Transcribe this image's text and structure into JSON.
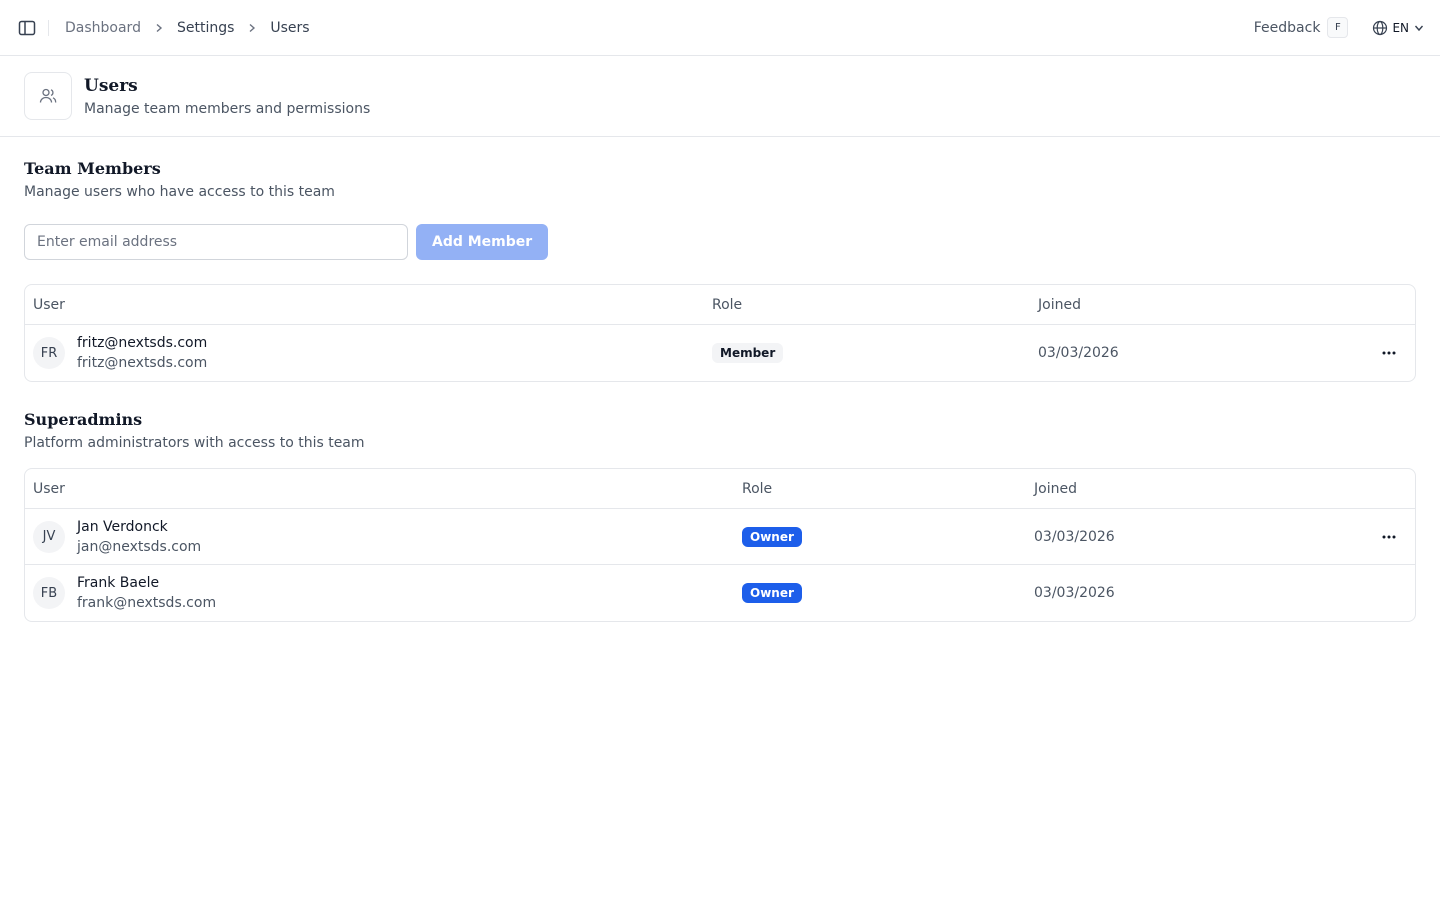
{
  "header": {
    "breadcrumb": [
      "Dashboard",
      "Settings",
      "Users"
    ],
    "feedback_label": "Feedback",
    "feedback_shortcut": "F",
    "language": "EN"
  },
  "page": {
    "title": "Users",
    "subtitle": "Manage team members and permissions"
  },
  "team": {
    "title": "Team Members",
    "subtitle": "Manage users who have access to this team",
    "email_placeholder": "Enter email address",
    "add_button": "Add Member",
    "columns": [
      "User",
      "Role",
      "Joined"
    ],
    "rows": [
      {
        "initials": "FR",
        "name": "fritz@nextsds.com",
        "email": "fritz@nextsds.com",
        "role": "Member",
        "joined": "03/03/2026"
      }
    ]
  },
  "superadmins": {
    "title": "Superadmins",
    "subtitle": "Platform administrators with access to this team",
    "columns": [
      "User",
      "Role",
      "Joined"
    ],
    "rows": [
      {
        "initials": "JV",
        "name": "Jan Verdonck",
        "email": "jan@nextsds.com",
        "role": "Owner",
        "joined": "03/03/2026"
      },
      {
        "initials": "FB",
        "name": "Frank Baele",
        "email": "frank@nextsds.com",
        "role": "Owner",
        "joined": "03/03/2026"
      }
    ]
  },
  "colors": {
    "primary_disabled": "#93b1f5",
    "owner_badge": "#1d5eea",
    "border": "#e5e7eb"
  }
}
